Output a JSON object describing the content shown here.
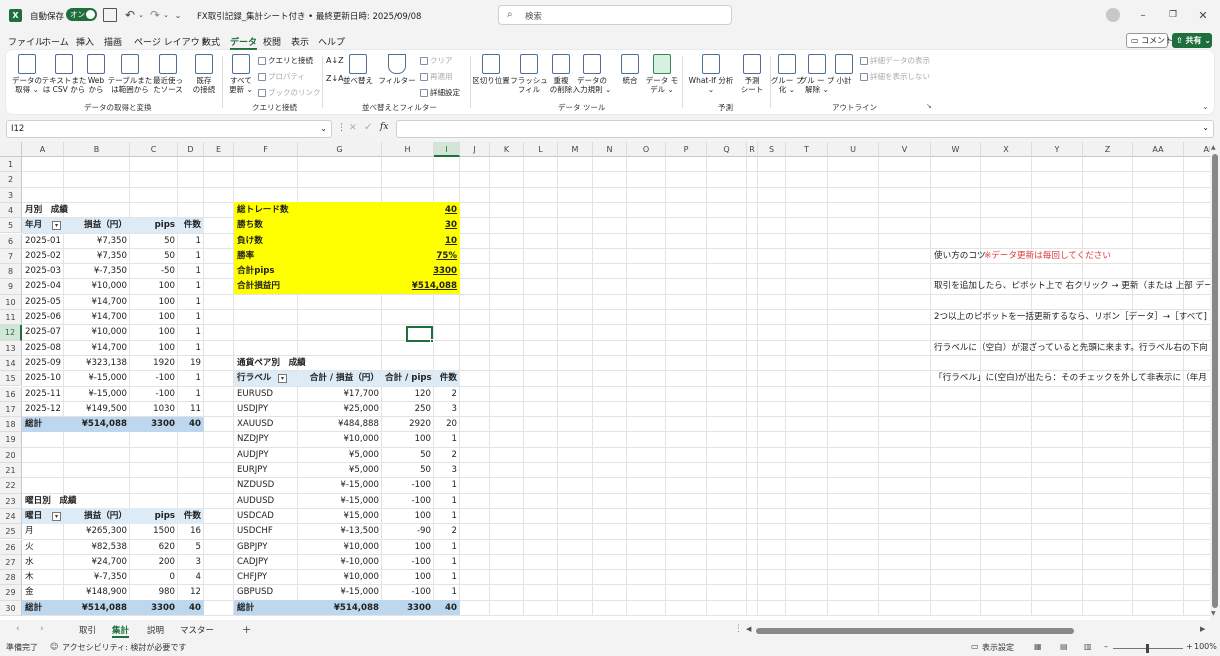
{
  "titlebar": {
    "autosave": "自動保存",
    "toggle": "オン",
    "filename": "FX取引記録_集計シート付き • 最終更新日時: 2025/09/08",
    "search_placeholder": "検索"
  },
  "menu": [
    "ファイル",
    "ホーム",
    "挿入",
    "描画",
    "ページ レイアウト",
    "数式",
    "データ",
    "校閲",
    "表示",
    "ヘルプ"
  ],
  "menu_active_index": 6,
  "buttons": {
    "comment": "コメント",
    "share": "共有"
  },
  "ribbon": {
    "large": [
      {
        "label": "データの\n取得 ⌄"
      },
      {
        "label": "テキストまた\nは CSV から"
      },
      {
        "label": "Web\nから"
      },
      {
        "label": "テーブルまた\nは範囲から"
      },
      {
        "label": "最近使っ\nたソース"
      },
      {
        "label": "既存\nの接続"
      },
      {
        "label": "すべて\n更新 ⌄"
      },
      {
        "label": "並べ替え"
      },
      {
        "label": "フィルター"
      },
      {
        "label": "区切り位置"
      },
      {
        "label": "フラッシュ\nフィル"
      },
      {
        "label": "重複\nの削除"
      },
      {
        "label": "データの\n入力規則 ⌄"
      },
      {
        "label": "統合"
      },
      {
        "label": "データ モ\nデル ⌄"
      },
      {
        "label": "What-If 分析\n⌄"
      },
      {
        "label": "予測\nシート"
      },
      {
        "label": "グルー プ\n化 ⌄"
      },
      {
        "label": "グル ー プ\n解除 ⌄"
      },
      {
        "label": "小計"
      }
    ],
    "small": [
      {
        "label": "クエリと接続",
        "disabled": false
      },
      {
        "label": "プロパティ",
        "disabled": true
      },
      {
        "label": "ブックのリンク",
        "disabled": true
      },
      {
        "label": "クリア",
        "disabled": true
      },
      {
        "label": "再適用",
        "disabled": true
      },
      {
        "label": "詳細設定",
        "disabled": false
      },
      {
        "label": "詳細データの表示",
        "disabled": true
      },
      {
        "label": "詳細を表示しない",
        "disabled": true
      }
    ],
    "groups": [
      "データの取得と変換",
      "クエリと接続",
      "並べ替えとフィルター",
      "データ ツール",
      "予測",
      "アウトライン"
    ]
  },
  "formula": {
    "namebox": "I12",
    "fx": "fx"
  },
  "columns": [
    "A",
    "B",
    "C",
    "D",
    "E",
    "F",
    "G",
    "H",
    "I",
    "J",
    "K",
    "L",
    "M",
    "N",
    "O",
    "P",
    "Q",
    "R",
    "S",
    "T",
    "U",
    "V",
    "W",
    "X",
    "Y",
    "Z",
    "AA",
    "AB"
  ],
  "rows": [
    "1",
    "2",
    "3",
    "4",
    "5",
    "6",
    "7",
    "8",
    "9",
    "10",
    "11",
    "12",
    "13",
    "14",
    "15",
    "16",
    "17",
    "18",
    "19",
    "20",
    "21",
    "22",
    "23",
    "24",
    "25",
    "26",
    "27",
    "28",
    "29",
    "30"
  ],
  "monthly": {
    "title": "月別　成績",
    "headers": [
      "年月",
      "損益（円）",
      "pips",
      "件数"
    ],
    "rows": [
      [
        "2025-01",
        "¥7,350",
        "50",
        "1"
      ],
      [
        "2025-02",
        "¥7,350",
        "50",
        "1"
      ],
      [
        "2025-03",
        "¥-7,350",
        "-50",
        "1"
      ],
      [
        "2025-04",
        "¥10,000",
        "100",
        "1"
      ],
      [
        "2025-05",
        "¥14,700",
        "100",
        "1"
      ],
      [
        "2025-06",
        "¥14,700",
        "100",
        "1"
      ],
      [
        "2025-07",
        "¥10,000",
        "100",
        "1"
      ],
      [
        "2025-08",
        "¥14,700",
        "100",
        "1"
      ],
      [
        "2025-09",
        "¥323,138",
        "1920",
        "19"
      ],
      [
        "2025-10",
        "¥-15,000",
        "-100",
        "1"
      ],
      [
        "2025-11",
        "¥-15,000",
        "-100",
        "1"
      ],
      [
        "2025-12",
        "¥149,500",
        "1030",
        "11"
      ]
    ],
    "total": [
      "総計",
      "¥514,088",
      "3300",
      "40"
    ]
  },
  "weekday": {
    "title": "曜日別　成績",
    "headers": [
      "曜日",
      "損益（円）",
      "pips",
      "件数"
    ],
    "rows": [
      [
        "月",
        "¥265,300",
        "1500",
        "16"
      ],
      [
        "火",
        "¥82,538",
        "620",
        "5"
      ],
      [
        "水",
        "¥24,700",
        "200",
        "3"
      ],
      [
        "木",
        "¥-7,350",
        "0",
        "4"
      ],
      [
        "金",
        "¥148,900",
        "980",
        "12"
      ]
    ],
    "total": [
      "総計",
      "¥514,088",
      "3300",
      "40"
    ]
  },
  "summary": [
    [
      "総トレード数",
      "40"
    ],
    [
      "勝ち数",
      "30"
    ],
    [
      "負け数",
      "10"
    ],
    [
      "勝率",
      "75%"
    ],
    [
      "合計pips",
      "3300"
    ],
    [
      "合計損益円",
      "¥514,088"
    ]
  ],
  "pairs": {
    "title": "通貨ペア別　成績",
    "headers": [
      "行ラベル",
      "合計 / 損益（円）",
      "合計 / pips",
      "件数"
    ],
    "rows": [
      [
        "EURUSD",
        "¥17,700",
        "120",
        "2"
      ],
      [
        "USDJPY",
        "¥25,000",
        "250",
        "3"
      ],
      [
        "XAUUSD",
        "¥484,888",
        "2920",
        "20"
      ],
      [
        "NZDJPY",
        "¥10,000",
        "100",
        "1"
      ],
      [
        "AUDJPY",
        "¥5,000",
        "50",
        "2"
      ],
      [
        "EURJPY",
        "¥5,000",
        "50",
        "3"
      ],
      [
        "NZDUSD",
        "¥-15,000",
        "-100",
        "1"
      ],
      [
        "AUDUSD",
        "¥-15,000",
        "-100",
        "1"
      ],
      [
        "USDCAD",
        "¥15,000",
        "100",
        "1"
      ],
      [
        "USDCHF",
        "¥-13,500",
        "-90",
        "2"
      ],
      [
        "GBPJPY",
        "¥10,000",
        "100",
        "1"
      ],
      [
        "CADJPY",
        "¥-10,000",
        "-100",
        "1"
      ],
      [
        "CHFJPY",
        "¥10,000",
        "100",
        "1"
      ],
      [
        "GBPUSD",
        "¥-15,000",
        "-100",
        "1"
      ]
    ],
    "total": [
      "総計",
      "¥514,088",
      "3300",
      "40"
    ]
  },
  "notes": {
    "tips_title": "使い方のコツ",
    "warning": "※データ更新は毎回してください",
    "lines": [
      "取引を追加したら、ピボット上で 右クリック → 更新（または 上部 デー",
      "2つ以上のピボットを一括更新するなら、リボン［データ］→［すべて]",
      "行ラベルに（空白）が混ざっていると先頭に来ます。行ラベル右の下向",
      "「行ラベル」に(空白)が出たら：そのチェックを外して非表示に（年月"
    ]
  },
  "sheets": [
    "取引",
    "集計",
    "説明",
    "マスター"
  ],
  "sheet_active_index": 1,
  "status": {
    "ready": "準備完了",
    "accessibility": "アクセシビリティ: 検討が必要です",
    "display_settings": "表示設定",
    "zoom": "100%"
  },
  "colors": {
    "excel_green": "#1e6f3c",
    "table_header": "#ddebf7",
    "table_total": "#bdd7ee",
    "summary_fill": "#ffff00",
    "warning_red": "#e0393e"
  }
}
